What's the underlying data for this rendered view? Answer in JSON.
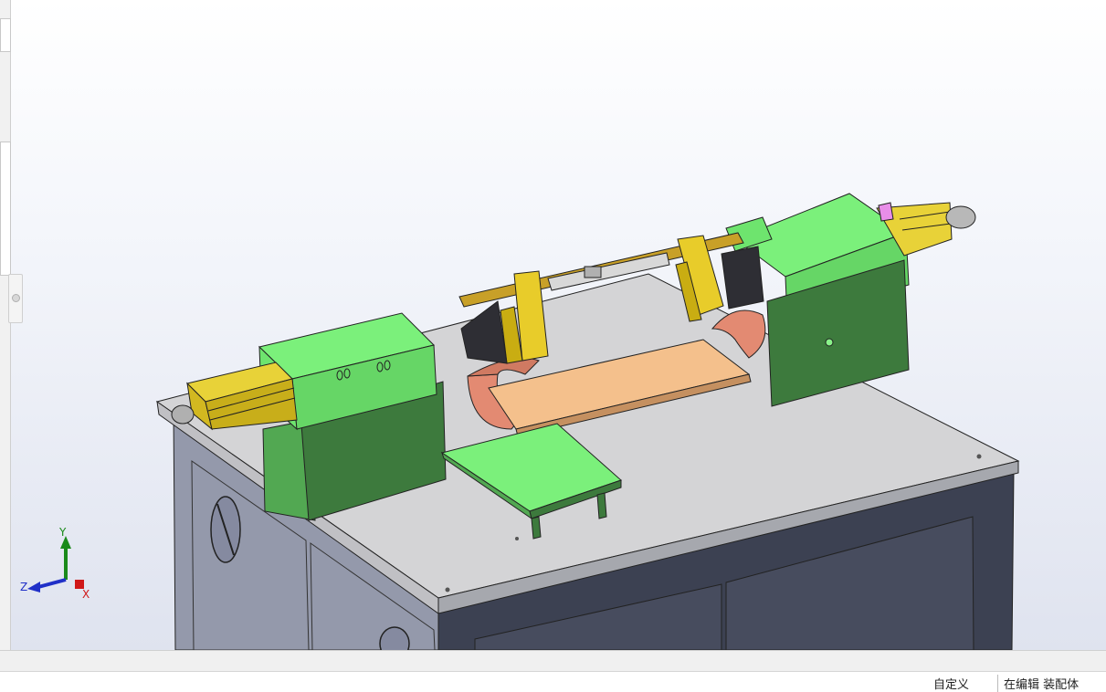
{
  "viewport": {
    "label": "3D model viewport"
  },
  "triad": {
    "x_label": "X",
    "y_label": "Y",
    "z_label": "Z",
    "x_color": "#d01818",
    "y_color": "#1a8a1a",
    "z_color": "#2030c8"
  },
  "status_bar": {
    "units": "自定义",
    "mode": "在编辑 装配体"
  },
  "colors": {
    "cabinet": "#8a8e9e",
    "tabletop": "#d2d2d4",
    "housing_green": "#72ee72",
    "copper": "#e08a70",
    "plate": "#f2c18a",
    "brass": "#e8cc2a"
  }
}
